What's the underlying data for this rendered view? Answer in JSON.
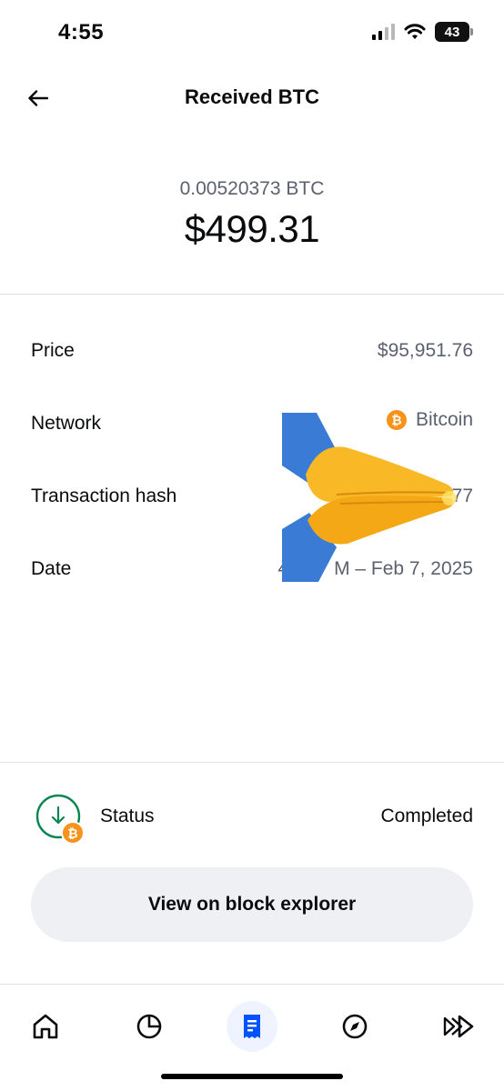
{
  "status_bar": {
    "time": "4:55",
    "battery": "43"
  },
  "header": {
    "title": "Received BTC",
    "back_icon": "arrow-left-icon"
  },
  "amount": {
    "crypto": "0.00520373 BTC",
    "fiat": "$499.31"
  },
  "details": {
    "price_label": "Price",
    "price_value": "$95,951.76",
    "network_label": "Network",
    "network_value": "Bitcoin",
    "network_icon": "bitcoin-icon",
    "hash_label": "Transaction hash",
    "hash_value": "77",
    "date_label": "Date",
    "date_value_left": "4:",
    "date_value_right": "M – Feb 7, 2025"
  },
  "status": {
    "label": "Status",
    "value": "Completed"
  },
  "explorer_button": {
    "label": "View on block explorer"
  },
  "bottom_nav": {
    "items": [
      "home-icon",
      "portfolio-pie-icon",
      "transactions-receipt-icon",
      "explore-compass-icon",
      "trade-forward-icon"
    ],
    "active": "transactions-receipt-icon"
  },
  "colors": {
    "accent": "#0052ff",
    "bitcoin": "#f7931a",
    "status_green": "#098551",
    "muted_text": "#5b616e"
  }
}
